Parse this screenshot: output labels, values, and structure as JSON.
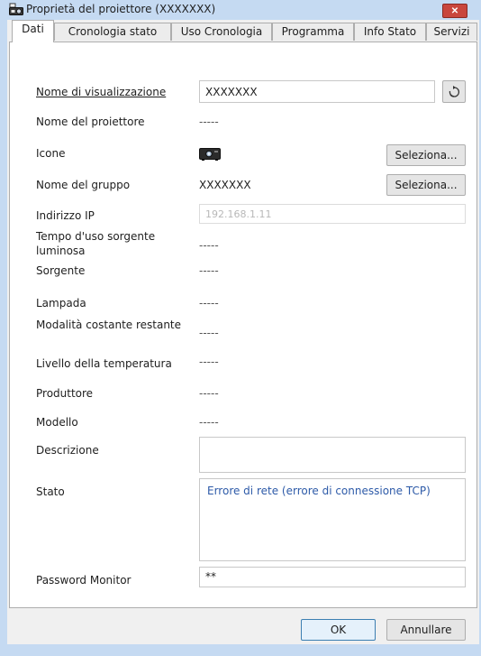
{
  "window": {
    "title": "Proprietà del proiettore (XXXXXXX)",
    "close_label": "✕"
  },
  "tabs": [
    {
      "label": "Dati",
      "active": true
    },
    {
      "label": "Cronologia stato",
      "active": false
    },
    {
      "label": "Uso Cronologia",
      "active": false
    },
    {
      "label": "Programma",
      "active": false
    },
    {
      "label": "Info Stato",
      "active": false
    },
    {
      "label": "Servizi",
      "active": false
    }
  ],
  "form": {
    "display_name_label": "Nome di visualizzazione",
    "display_name_value": "XXXXXXX",
    "projector_name_label": "Nome del proiettore",
    "projector_name_value": "-----",
    "icon_label": "Icone",
    "icon_select_label": "Seleziona...",
    "group_name_label": "Nome del gruppo",
    "group_name_value": "XXXXXXX",
    "group_select_label": "Seleziona...",
    "ip_label": "Indirizzo IP",
    "ip_value": "192.168.1.11",
    "light_source_time_label": "Tempo d'uso sorgente luminosa",
    "light_source_time_value": "-----",
    "source_label": "Sorgente",
    "source_value": "-----",
    "lamp_label": "Lampada",
    "lamp_value": "-----",
    "constant_mode_label": "Modalità costante restante",
    "constant_mode_value": "-----",
    "temperature_label": "Livello della temperatura",
    "temperature_value": "-----",
    "manufacturer_label": "Produttore",
    "manufacturer_value": "-----",
    "model_label": "Modello",
    "model_value": "-----",
    "description_label": "Descrizione",
    "description_value": "",
    "status_label": "Stato",
    "status_value": "Errore di rete (errore di connessione TCP)",
    "password_label": "Password Monitor",
    "password_value": "**"
  },
  "buttons": {
    "ok_label": "OK",
    "cancel_label": "Annullare"
  },
  "colors": {
    "window_frame": "#c5daf2",
    "status_text": "#2d5aa8",
    "close_button": "#c9463d"
  }
}
